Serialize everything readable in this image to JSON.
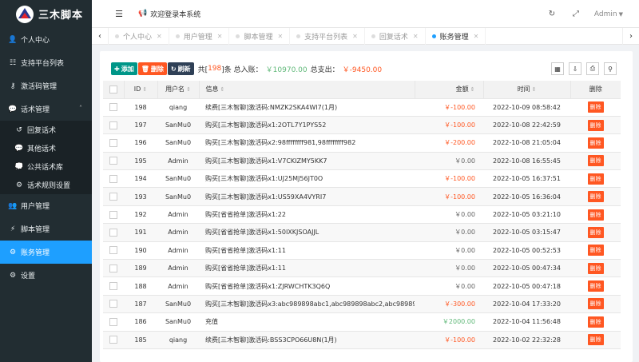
{
  "brand": {
    "title": "三木脚本"
  },
  "sidebar": {
    "items": [
      {
        "icon": "user-icon",
        "glyph": "👤",
        "label": "个人中心"
      },
      {
        "icon": "list-icon",
        "glyph": "☷",
        "label": "支持平台列表"
      },
      {
        "icon": "key-icon",
        "glyph": "⚷",
        "label": "激活码管理"
      },
      {
        "icon": "comments-icon",
        "glyph": "💬",
        "label": "话术管理",
        "expanded": true
      }
    ],
    "sub_items": [
      {
        "icon": "reply-icon",
        "glyph": "↺",
        "label": "回复话术"
      },
      {
        "icon": "comment-icon",
        "glyph": "💬",
        "label": "其他话术"
      },
      {
        "icon": "comments-icon",
        "glyph": "💭",
        "label": "公共话术库"
      },
      {
        "icon": "sliders-icon",
        "glyph": "⚙",
        "label": "话术规则设置"
      }
    ],
    "items_after": [
      {
        "icon": "users-icon",
        "glyph": "👥",
        "label": "用户管理"
      },
      {
        "icon": "code-icon",
        "glyph": "⚡",
        "label": "脚本管理"
      },
      {
        "icon": "cog-icon",
        "glyph": "⚙",
        "label": "账务管理",
        "active": true
      },
      {
        "icon": "gears-icon",
        "glyph": "⚙",
        "label": "设置"
      }
    ]
  },
  "header": {
    "welcome": "欢迎登录本系统",
    "user": "Admin"
  },
  "tabs": [
    {
      "label": "个人中心",
      "active": false
    },
    {
      "label": "用户管理",
      "active": false
    },
    {
      "label": "脚本管理",
      "active": false
    },
    {
      "label": "支持平台列表",
      "active": false
    },
    {
      "label": "回复话术",
      "active": false
    },
    {
      "label": "账务管理",
      "active": true
    }
  ],
  "toolbar": {
    "add_label": "添加",
    "delete_label": "删除",
    "refresh_label": "刷新",
    "count_prefix": "共[",
    "count": "198",
    "count_suffix": "]条",
    "income_label": "总入账：",
    "income": "￥10970.00",
    "expense_label": "总支出：",
    "expense": "￥-9450.00"
  },
  "table": {
    "headers": {
      "id": "ID",
      "username": "用户名",
      "info": "信息",
      "amount": "金额",
      "time": "时间",
      "delete": "删除"
    },
    "delete_label": "删除",
    "rows": [
      {
        "id": "198",
        "username": "qiang",
        "info": "续费[三木智聊]激活码:NMZK2SKA4WI7(1月)",
        "amount": "￥-100.00",
        "kind": "neg",
        "time": "2022-10-09 08:58:42"
      },
      {
        "id": "197",
        "username": "SanMu0",
        "info": "购买[三木智聊]激活码x1:2OTL7Y1PYS52",
        "amount": "￥-100.00",
        "kind": "neg",
        "time": "2022-10-08 22:42:59"
      },
      {
        "id": "196",
        "username": "SanMu0",
        "info": "购买[三木智聊]激活码x2:98ffffffff981,98ffffffff982",
        "amount": "￥-200.00",
        "kind": "neg",
        "time": "2022-10-08 21:05:04"
      },
      {
        "id": "195",
        "username": "Admin",
        "info": "购买[三木智聊]激活码x1:V7CKIZMY5KK7",
        "amount": "￥0.00",
        "kind": "zero",
        "time": "2022-10-08 16:55:45"
      },
      {
        "id": "194",
        "username": "SanMu0",
        "info": "购买[三木智聊]激活码x1:UJ25MJ56JT0O",
        "amount": "￥-100.00",
        "kind": "neg",
        "time": "2022-10-05 16:37:51"
      },
      {
        "id": "193",
        "username": "SanMu0",
        "info": "购买[三木智聊]激活码x1:US59XA4VYRI7",
        "amount": "￥-100.00",
        "kind": "neg",
        "time": "2022-10-05 16:36:04"
      },
      {
        "id": "192",
        "username": "Admin",
        "info": "购买[省省抢单]激活码x1:22",
        "amount": "￥0.00",
        "kind": "zero",
        "time": "2022-10-05 03:21:10"
      },
      {
        "id": "191",
        "username": "Admin",
        "info": "购买[省省抢单]激活码x1:50IXKJSOAJJL",
        "amount": "￥0.00",
        "kind": "zero",
        "time": "2022-10-05 03:15:47"
      },
      {
        "id": "190",
        "username": "Admin",
        "info": "购买[省省抢单]激活码x1:11",
        "amount": "￥0.00",
        "kind": "zero",
        "time": "2022-10-05 00:52:53"
      },
      {
        "id": "189",
        "username": "Admin",
        "info": "购买[省省抢单]激活码x1:11",
        "amount": "￥0.00",
        "kind": "zero",
        "time": "2022-10-05 00:47:34"
      },
      {
        "id": "188",
        "username": "Admin",
        "info": "购买[省省抢单]激活码x1:ZJRWCHTK3Q6Q",
        "amount": "￥0.00",
        "kind": "zero",
        "time": "2022-10-05 00:47:18"
      },
      {
        "id": "187",
        "username": "SanMu0",
        "info": "购买[三木智聊]激活码x3:abc989898abc1,abc989898abc2,abc989898abc3",
        "amount": "￥-300.00",
        "kind": "neg",
        "time": "2022-10-04 17:33:20"
      },
      {
        "id": "186",
        "username": "SanMu0",
        "info": "充值",
        "amount": "￥2000.00",
        "kind": "pos",
        "time": "2022-10-04 11:56:48"
      },
      {
        "id": "185",
        "username": "qiang",
        "info": "续费[三木智聊]激活码:BSS3CPO66U8N(1月)",
        "amount": "￥-100.00",
        "kind": "neg",
        "time": "2022-10-02 22:32:28"
      }
    ]
  }
}
